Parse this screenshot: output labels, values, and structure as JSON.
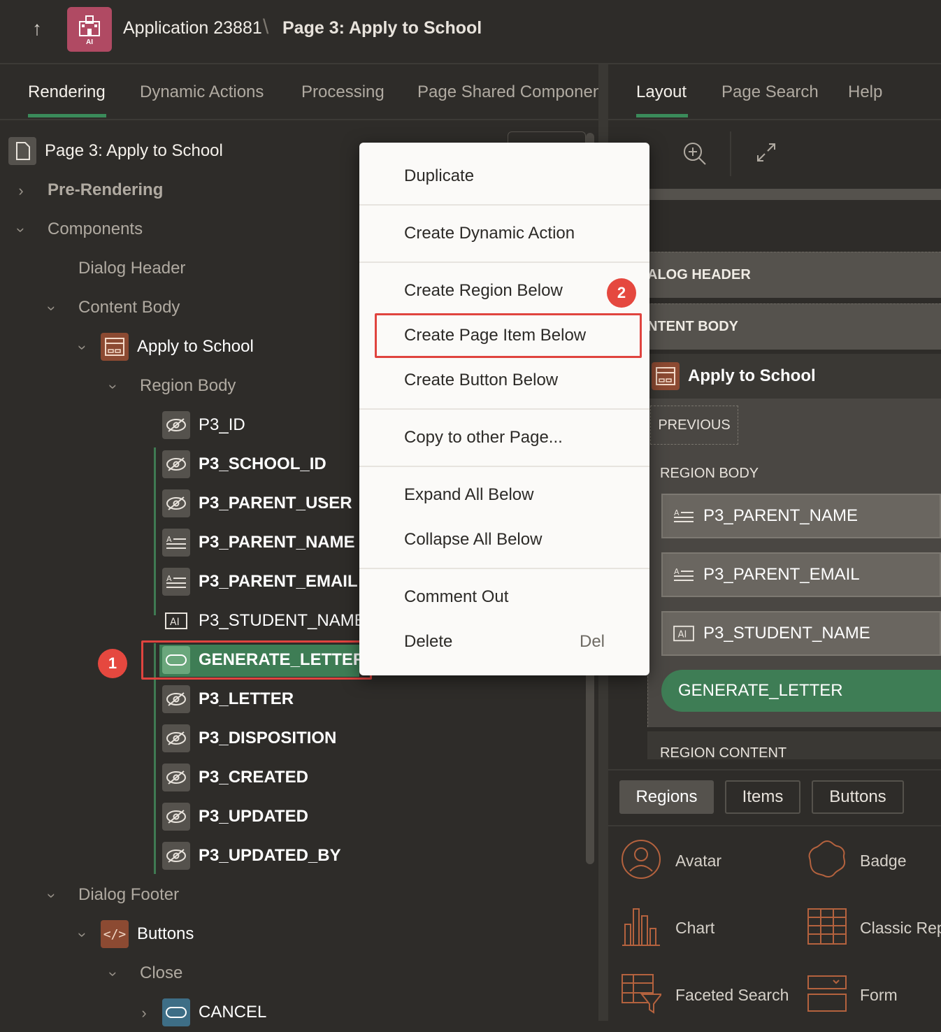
{
  "header": {
    "app_name": "Application 23881",
    "separator": "\\",
    "page_title": "Page 3: Apply to School",
    "app_icon_text": "AI"
  },
  "left_tabs": [
    "Rendering",
    "Dynamic Actions",
    "Processing",
    "Page Shared Componen"
  ],
  "right_tabs": [
    "Layout",
    "Page Search",
    "Help"
  ],
  "tree": {
    "page": "Page 3: Apply to School",
    "pre_rendering": "Pre-Rendering",
    "components": "Components",
    "dialog_header": "Dialog Header",
    "content_body": "Content Body",
    "region": "Apply to School",
    "region_body": "Region Body",
    "items": [
      "P3_ID",
      "P3_SCHOOL_ID",
      "P3_PARENT_USER",
      "P3_PARENT_NAME",
      "P3_PARENT_EMAIL",
      "P3_STUDENT_NAME",
      "GENERATE_LETTER",
      "P3_LETTER",
      "P3_DISPOSITION",
      "P3_CREATED",
      "P3_UPDATED",
      "P3_UPDATED_BY"
    ],
    "dialog_footer": "Dialog Footer",
    "buttons": "Buttons",
    "close": "Close",
    "cancel": "CANCEL"
  },
  "context_menu": {
    "items": [
      "Duplicate",
      "Create Dynamic Action",
      "Create Region Below",
      "Create Page Item Below",
      "Create Button Below",
      "Copy to other Page...",
      "Expand All Below",
      "Collapse All Below",
      "Comment Out",
      "Delete"
    ],
    "delete_shortcut": "Del"
  },
  "badges": {
    "one": "1",
    "two": "2"
  },
  "layout": {
    "dialog_header": "ALOG HEADER",
    "content_body": "NTENT BODY",
    "region_title": "Apply to School",
    "previous": "PREVIOUS",
    "region_body": "REGION BODY",
    "fields": [
      "P3_PARENT_NAME",
      "P3_PARENT_EMAIL",
      "P3_STUDENT_NAME"
    ],
    "button": "GENERATE_LETTER",
    "region_content": "REGION CONTENT"
  },
  "gallery": {
    "tabs": [
      "Regions",
      "Items",
      "Buttons"
    ],
    "items": [
      "Avatar",
      "Badge",
      "Chart",
      "Classic Repo",
      "Faceted Search",
      "Form"
    ]
  },
  "colors": {
    "accent_green": "#3e7d55",
    "highlight_red": "#e0443f",
    "region_icon": "#8c4a32"
  }
}
